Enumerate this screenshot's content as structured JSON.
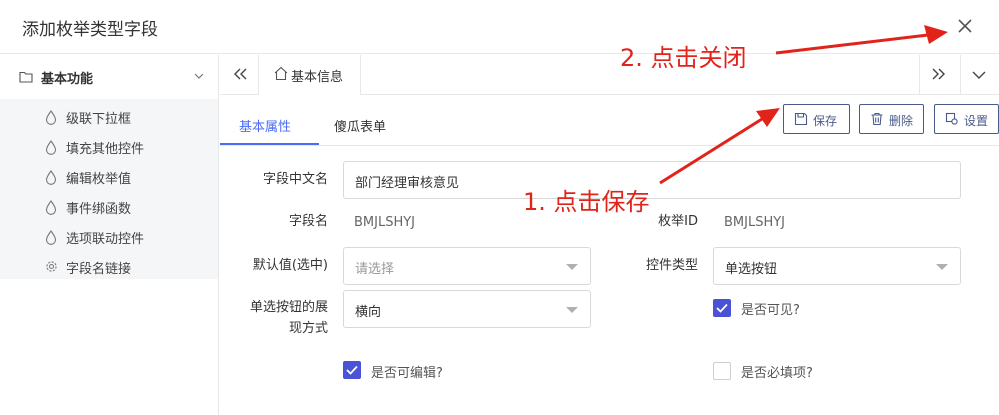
{
  "dialog": {
    "title": "添加枚举类型字段"
  },
  "sidebar": {
    "group_label": "基本功能",
    "items": [
      {
        "label": "级联下拉框",
        "icon": "drop-icon"
      },
      {
        "label": "填充其他控件",
        "icon": "drop-icon"
      },
      {
        "label": "编辑枚举值",
        "icon": "drop-icon"
      },
      {
        "label": "事件绑函数",
        "icon": "drop-icon"
      },
      {
        "label": "选项联动控件",
        "icon": "drop-icon"
      },
      {
        "label": "字段名链接",
        "icon": "gear-icon"
      }
    ]
  },
  "tabs": {
    "page_tab": "基本信息"
  },
  "subtabs": {
    "basic": "基本属性",
    "fool_form": "傻瓜表单"
  },
  "toolbar": {
    "save": "保存",
    "delete": "删除",
    "settings": "设置"
  },
  "form": {
    "cn_name_label": "字段中文名",
    "cn_name_value": "部门经理审核意见",
    "field_name_label": "字段名",
    "field_name_value": "BMJLSHYJ",
    "enum_id_label": "枚举ID",
    "enum_id_value": "BMJLSHYJ",
    "default_label": "默认值(选中)",
    "default_placeholder": "请选择",
    "control_type_label": "控件类型",
    "control_type_value": "单选按钮",
    "radio_display_label_1": "单选按钮的展",
    "radio_display_label_2": "现方式",
    "radio_display_value": "横向",
    "visible_label": "是否可见?",
    "visible_checked": true,
    "editable_label": "是否可编辑?",
    "editable_checked": true,
    "required_label": "是否必填项?",
    "required_checked": false
  },
  "annotations": {
    "step1": "1. 点击保存",
    "step2": "2. 点击关闭"
  },
  "colors": {
    "accent": "#4a6cf7",
    "annotation": "#e2231a",
    "checkbox": "#4a52d8"
  }
}
